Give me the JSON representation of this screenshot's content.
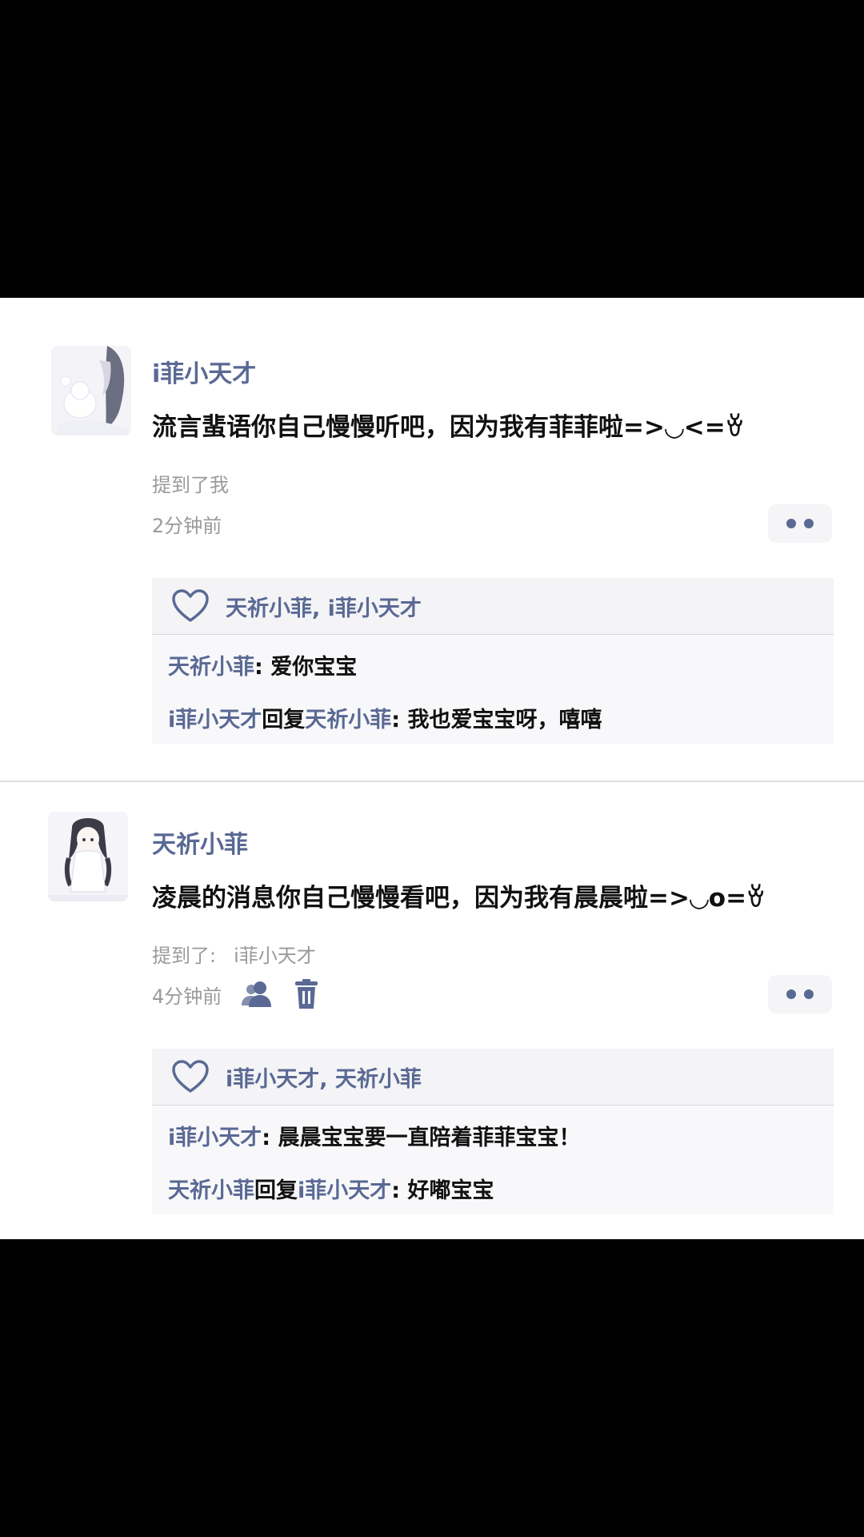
{
  "posts": [
    {
      "username": "i菲小天才",
      "content": "流言蜚语你自己慢慢听吧，因为我有菲菲啦=>◡<=ꈊ",
      "mention_label": "提到了我",
      "mention_user": "",
      "time": "2分钟前",
      "likes": "天祈小菲, i菲小天才",
      "replies": [
        {
          "from": "天祈小菲",
          "connector": "",
          "to": "",
          "sep": ": ",
          "text": "爱你宝宝"
        },
        {
          "from": "i菲小天才",
          "connector": "回复",
          "to": "天祈小菲",
          "sep": ": ",
          "text": "我也爱宝宝呀，嘻嘻"
        }
      ]
    },
    {
      "username": "天祈小菲",
      "content": "凌晨的消息你自己慢慢看吧，因为我有晨晨啦=>◡o=ꈊ",
      "mention_label": "提到了:",
      "mention_user": "i菲小天才",
      "time": "4分钟前",
      "likes": "i菲小天才, 天祈小菲",
      "replies": [
        {
          "from": "i菲小天才",
          "connector": "",
          "to": "",
          "sep": ": ",
          "text": "晨晨宝宝要一直陪着菲菲宝宝！"
        },
        {
          "from": "天祈小菲",
          "connector": "回复",
          "to": "i菲小天才",
          "sep": ": ",
          "text": "好嘟宝宝"
        }
      ]
    }
  ],
  "icons": {
    "like": "heart-icon",
    "more": "more-dots-icon",
    "visibility": "users-icon",
    "delete": "trash-icon"
  },
  "colors": {
    "name": "#5a6994",
    "text": "#111111",
    "muted": "#9a9a9a",
    "panel": "#f4f4f6"
  }
}
